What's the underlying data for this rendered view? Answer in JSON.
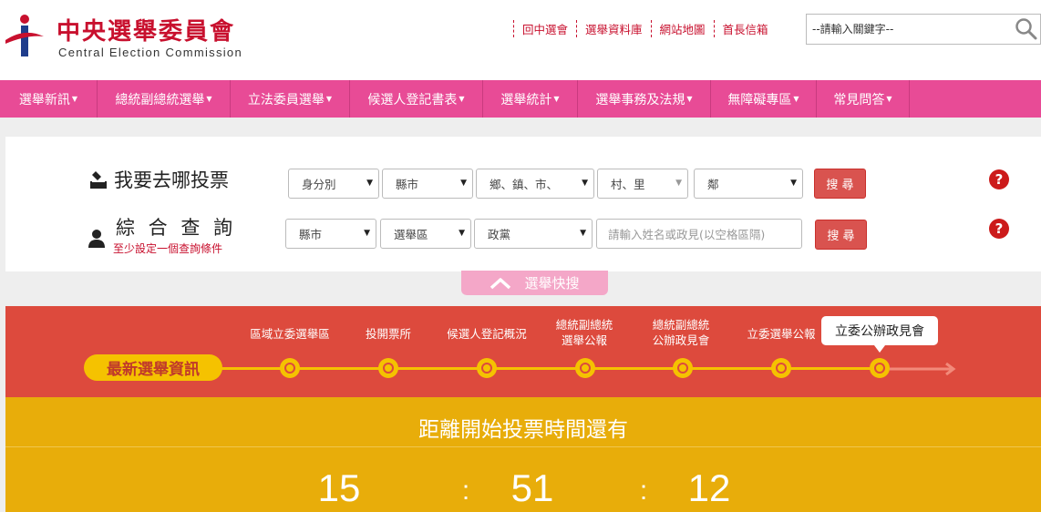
{
  "header": {
    "org_name": "中央選舉委員會",
    "org_name_en": "Central Election Commission",
    "links": [
      "回中選會",
      "選舉資料庫",
      "網站地圖",
      "首長信箱"
    ],
    "search_placeholder": "--請輸入關鍵字--",
    "brand_color": "#c8102e"
  },
  "nav": {
    "items": [
      "選舉新訊",
      "總統副總統選舉",
      "立法委員選舉",
      "候選人登記書表",
      "選舉統計",
      "選舉事務及法規",
      "無障礙專區",
      "常見問答"
    ],
    "bg_color": "#e84b96"
  },
  "quick_search": {
    "row1": {
      "title": "我要去哪投票",
      "selects": [
        "身分別",
        "縣市",
        "鄉、鎮、市、",
        "村、里",
        "鄰"
      ],
      "button": "搜 尋",
      "help": "?"
    },
    "row2": {
      "title": "綜 合 查 詢",
      "hint": "至少設定一個查詢條件",
      "selects": [
        "縣市",
        "選舉區",
        "政黨"
      ],
      "input_placeholder": "請輸入姓名或政見(以空格區隔)",
      "button": "搜 尋",
      "help": "?"
    },
    "tab_label": "選舉快搜"
  },
  "timeline": {
    "badge": "最新選舉資訊",
    "items": [
      "區域立委選舉區",
      "投開票所",
      "候選人登記概況",
      "總統副總統\n選舉公報",
      "總統副總統\n公辦政見會",
      "立委選舉公報",
      "立委公辦政見會"
    ],
    "active_index": 6,
    "bg_color": "#dd4a3d",
    "accent_color": "#f5c200"
  },
  "countdown": {
    "title": "距離開始投票時間還有",
    "values": [
      "15",
      "51",
      "12"
    ],
    "separator": ":",
    "bg_color": "#e8ad0a"
  }
}
